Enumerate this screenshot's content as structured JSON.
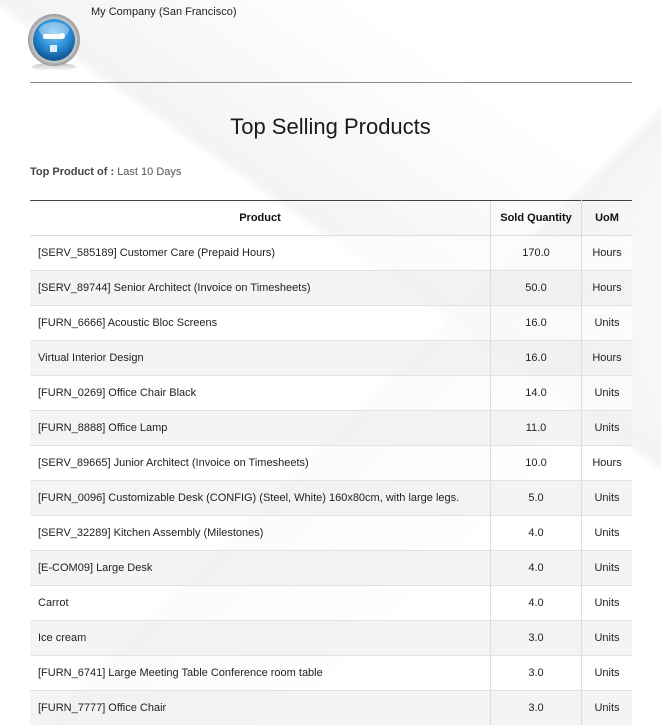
{
  "company": {
    "name": "My Company (San Francisco)"
  },
  "report": {
    "title": "Top Selling Products",
    "filter_label": "Top Product of :",
    "filter_value": "Last 10 Days"
  },
  "table": {
    "headers": {
      "product": "Product",
      "sold_quantity": "Sold Quantity",
      "uom": "UoM"
    },
    "rows": [
      {
        "product": "[SERV_585189] Customer Care (Prepaid Hours)",
        "qty": "170.0",
        "uom": "Hours"
      },
      {
        "product": "[SERV_89744] Senior Architect (Invoice on Timesheets)",
        "qty": "50.0",
        "uom": "Hours"
      },
      {
        "product": "[FURN_6666] Acoustic Bloc Screens",
        "qty": "16.0",
        "uom": "Units"
      },
      {
        "product": "Virtual Interior Design",
        "qty": "16.0",
        "uom": "Hours"
      },
      {
        "product": "[FURN_0269] Office Chair Black",
        "qty": "14.0",
        "uom": "Units"
      },
      {
        "product": "[FURN_8888] Office Lamp",
        "qty": "11.0",
        "uom": "Units"
      },
      {
        "product": "[SERV_89665] Junior Architect (Invoice on Timesheets)",
        "qty": "10.0",
        "uom": "Hours"
      },
      {
        "product": "[FURN_0096] Customizable Desk (CONFIG) (Steel, White) 160x80cm, with large legs.",
        "qty": "5.0",
        "uom": "Units"
      },
      {
        "product": "[SERV_32289] Kitchen Assembly (Milestones)",
        "qty": "4.0",
        "uom": "Units"
      },
      {
        "product": "[E-COM09] Large Desk",
        "qty": "4.0",
        "uom": "Units"
      },
      {
        "product": "Carrot",
        "qty": "4.0",
        "uom": "Units"
      },
      {
        "product": "Ice cream",
        "qty": "3.0",
        "uom": "Units"
      },
      {
        "product": "[FURN_6741] Large Meeting Table Conference room table",
        "qty": "3.0",
        "uom": "Units"
      },
      {
        "product": "[FURN_7777] Office Chair",
        "qty": "3.0",
        "uom": "Units"
      }
    ]
  },
  "colors": {
    "logo_blue": "#2a8fd6",
    "rule": "#8a8a8a",
    "row_alt": "#f0f0f0"
  },
  "icons": {
    "logo": "company-logo-icon"
  }
}
